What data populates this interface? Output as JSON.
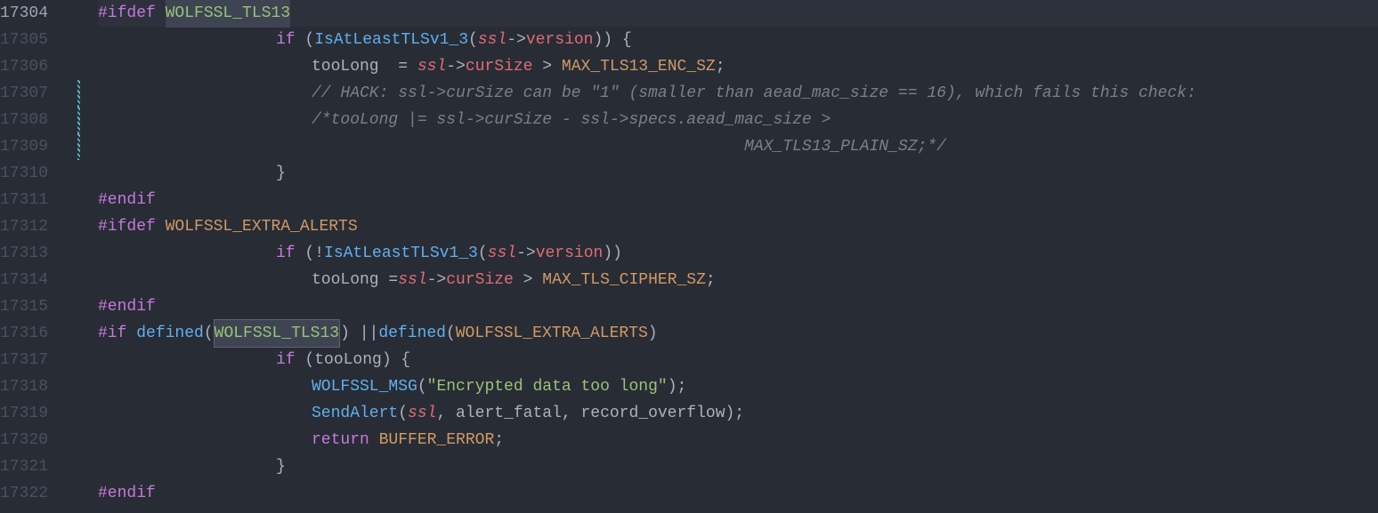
{
  "lines": [
    {
      "no": "17304",
      "active": true,
      "segments": [
        {
          "t": "#ifdef",
          "cls": "kw-pp"
        },
        {
          "t": " "
        },
        {
          "t": "WOLFSSL_TLS13",
          "cls": "def-const-green highlight"
        }
      ],
      "indent": 0
    },
    {
      "no": "17305",
      "segments": [
        {
          "t": "if",
          "cls": "kw-ctrl"
        },
        {
          "t": " ("
        },
        {
          "t": "IsAtLeastTLSv1_3",
          "cls": "fn"
        },
        {
          "t": "("
        },
        {
          "t": "ssl",
          "cls": "var-em"
        },
        {
          "t": "->"
        },
        {
          "t": "version",
          "cls": "prop"
        },
        {
          "t": ")) {"
        }
      ],
      "indent": 5
    },
    {
      "no": "17306",
      "segments": [
        {
          "t": "tooLong",
          "cls": "pale"
        },
        {
          "t": "  = "
        },
        {
          "t": "ssl",
          "cls": "var-em"
        },
        {
          "t": "->"
        },
        {
          "t": "curSize",
          "cls": "prop"
        },
        {
          "t": " > "
        },
        {
          "t": "MAX_TLS13_ENC_SZ",
          "cls": "num-const"
        },
        {
          "t": ";"
        }
      ],
      "indent": 6
    },
    {
      "no": "17307",
      "git": true,
      "segments": [
        {
          "t": "// HACK: ssl->curSize can be \"1\" (smaller than aead_mac_size == 16), which fails this check:",
          "cls": "com"
        }
      ],
      "indent": 6
    },
    {
      "no": "17308",
      "git": true,
      "segments": [
        {
          "t": "/*tooLong |= ssl->curSize - ssl->specs.aead_mac_size >",
          "cls": "com"
        }
      ],
      "indent": 6
    },
    {
      "no": "17309",
      "git": true,
      "segments": [
        {
          "t": "                                             MAX_TLS13_PLAIN_SZ;*/",
          "cls": "com"
        }
      ],
      "indent": 6
    },
    {
      "no": "17310",
      "segments": [
        {
          "t": "}",
          "cls": "punct"
        }
      ],
      "indent": 5
    },
    {
      "no": "17311",
      "segments": [
        {
          "t": "#endif",
          "cls": "kw-pp"
        }
      ],
      "indent": 0
    },
    {
      "no": "17312",
      "segments": [
        {
          "t": "#ifdef",
          "cls": "kw-pp"
        },
        {
          "t": " "
        },
        {
          "t": "WOLFSSL_EXTRA_ALERTS",
          "cls": "def-const"
        }
      ],
      "indent": 0
    },
    {
      "no": "17313",
      "segments": [
        {
          "t": "if",
          "cls": "kw-ctrl"
        },
        {
          "t": " ("
        },
        {
          "t": "!",
          "cls": "punct"
        },
        {
          "t": "IsAtLeastTLSv1_3",
          "cls": "fn"
        },
        {
          "t": "("
        },
        {
          "t": "ssl",
          "cls": "var-em"
        },
        {
          "t": "->"
        },
        {
          "t": "version",
          "cls": "prop"
        },
        {
          "t": "))"
        }
      ],
      "indent": 5
    },
    {
      "no": "17314",
      "segments": [
        {
          "t": "tooLong = "
        },
        {
          "t": "ssl",
          "cls": "var-em"
        },
        {
          "t": "->"
        },
        {
          "t": "curSize",
          "cls": "prop"
        },
        {
          "t": " > "
        },
        {
          "t": "MAX_TLS_CIPHER_SZ",
          "cls": "num-const"
        },
        {
          "t": ";"
        }
      ],
      "indent": 6
    },
    {
      "no": "17315",
      "segments": [
        {
          "t": "#endif",
          "cls": "kw-pp"
        }
      ],
      "indent": 0
    },
    {
      "no": "17316",
      "segments": [
        {
          "t": "#if",
          "cls": "kw-pp"
        },
        {
          "t": " "
        },
        {
          "t": "defined",
          "cls": "fn"
        },
        {
          "t": "("
        },
        {
          "t": "WOLFSSL_TLS13",
          "cls": "def-const-green highlight-border"
        },
        {
          "t": ") || "
        },
        {
          "t": "defined",
          "cls": "fn"
        },
        {
          "t": "("
        },
        {
          "t": "WOLFSSL_EXTRA_ALERTS",
          "cls": "def-const"
        },
        {
          "t": ")"
        }
      ],
      "indent": 0
    },
    {
      "no": "17317",
      "segments": [
        {
          "t": "if",
          "cls": "kw-ctrl"
        },
        {
          "t": " (tooLong) {"
        }
      ],
      "indent": 5
    },
    {
      "no": "17318",
      "segments": [
        {
          "t": "WOLFSSL_MSG",
          "cls": "fn"
        },
        {
          "t": "("
        },
        {
          "t": "\"Encrypted data too long\"",
          "cls": "str"
        },
        {
          "t": ");"
        }
      ],
      "indent": 6
    },
    {
      "no": "17319",
      "segments": [
        {
          "t": "SendAlert",
          "cls": "fn"
        },
        {
          "t": "("
        },
        {
          "t": "ssl",
          "cls": "var-em"
        },
        {
          "t": ", alert_fatal, record_overflow);"
        }
      ],
      "indent": 6
    },
    {
      "no": "17320",
      "segments": [
        {
          "t": "return",
          "cls": "kw-ctrl"
        },
        {
          "t": " "
        },
        {
          "t": "BUFFER_ERROR",
          "cls": "num-const"
        },
        {
          "t": ";"
        }
      ],
      "indent": 6
    },
    {
      "no": "17321",
      "segments": [
        {
          "t": "}",
          "cls": "punct"
        }
      ],
      "indent": 5
    },
    {
      "no": "17322",
      "segments": [
        {
          "t": "#endif",
          "cls": "kw-pp"
        }
      ],
      "indent": 0
    }
  ]
}
